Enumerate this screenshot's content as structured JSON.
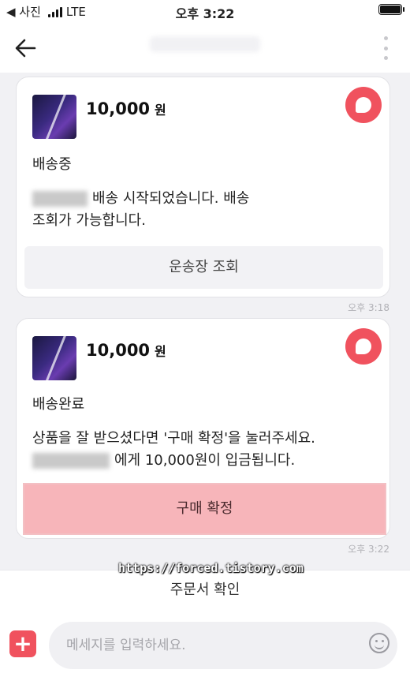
{
  "status_bar": {
    "carrier": "◀ 사진",
    "network": "LTE",
    "time": "오후 3:22"
  },
  "messages": [
    {
      "price": "10,000",
      "unit": "원",
      "status": "배송중",
      "body_line1": "배송 시작되었습니다. 배송",
      "body_line2": "조회가 가능합니다.",
      "button": "운송장 조회",
      "time": "오후 3:18"
    },
    {
      "price": "10,000",
      "unit": "원",
      "status": "배송완료",
      "body_line1": "상품을 잘 받으셨다면 '구매 확정'을 눌러주세요.",
      "body_line2": "에게 10,000원이 입금됩니다.",
      "button": "구매 확정",
      "time": "오후 3:22"
    }
  ],
  "watermark": "https://forced.tistory.com",
  "order_confirm": "주문서 확인",
  "input": {
    "placeholder": "메세지를 입력하세요."
  },
  "colors": {
    "accent": "#f0525e",
    "confirm_button": "#f7b5ba"
  }
}
